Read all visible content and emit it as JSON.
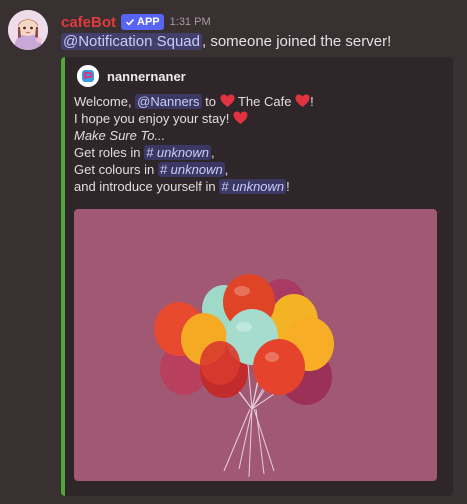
{
  "message": {
    "username": "cafeBot",
    "app_badge": "APP",
    "timestamp": "1:31 PM",
    "mention": "@Notification Squad",
    "text": ", someone joined the server!"
  },
  "embed": {
    "author": "nannernaner",
    "accent_color": "#4fa837",
    "lines": {
      "welcome_prefix": "Welcome, ",
      "welcome_mention": "@Nanners",
      "welcome_to": " to ",
      "welcome_place": " The Cafe ",
      "welcome_end": "!",
      "enjoy": "I hope you enjoy your stay! ",
      "make_sure": "Make Sure To...",
      "roles_prefix": "Get roles in ",
      "roles_channel": "# unknown",
      "roles_end": ",",
      "colours_prefix": "Get colours in ",
      "colours_channel": "# unknown",
      "colours_end": ",",
      "intro_prefix": "and introduce yourself in ",
      "intro_channel": "# unknown",
      "intro_end": "!"
    },
    "image": {
      "description_icon": "balloons-image",
      "background_color": "#a05873"
    }
  },
  "colors": {
    "username": "#e03b3b",
    "app_badge": "#5865f2",
    "heart": "#e0323f"
  }
}
